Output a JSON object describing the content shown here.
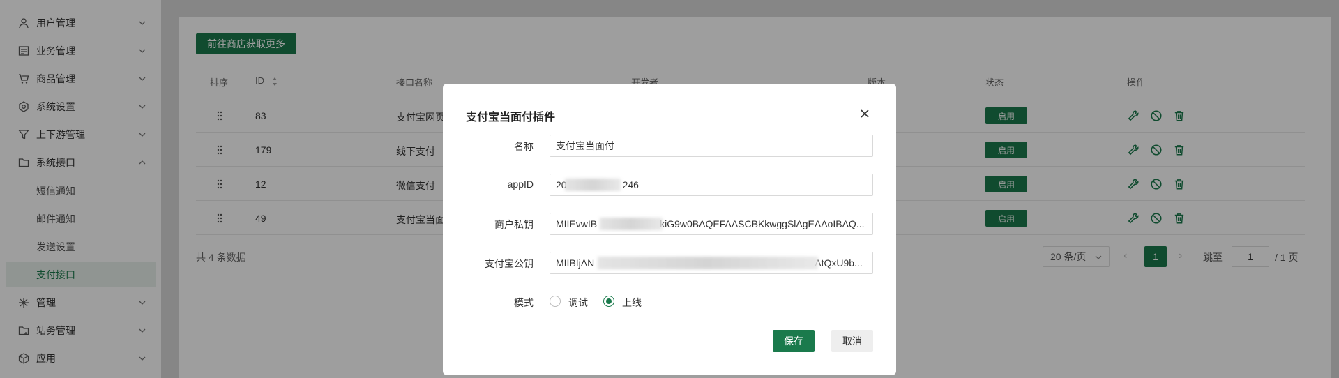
{
  "sidebar": {
    "items": [
      {
        "label": "用户管理",
        "icon": "user-icon"
      },
      {
        "label": "业务管理",
        "icon": "list-icon"
      },
      {
        "label": "商品管理",
        "icon": "cart-icon"
      },
      {
        "label": "系统设置",
        "icon": "gear-icon"
      },
      {
        "label": "上下游管理",
        "icon": "filter-icon"
      },
      {
        "label": "系统接口",
        "icon": "folder-icon"
      },
      {
        "label": "管理",
        "icon": "sparkle-icon"
      },
      {
        "label": "站务管理",
        "icon": "folder-add-icon"
      },
      {
        "label": "应用",
        "icon": "box-icon"
      }
    ],
    "sub_items": [
      "短信通知",
      "邮件通知",
      "发送设置",
      "支付接口"
    ]
  },
  "toolbar": {
    "store_button": "前往商店获取更多"
  },
  "table": {
    "headers": {
      "sort": "排序",
      "id": "ID",
      "name": "接口名称",
      "developer": "开发者",
      "version": "版本",
      "status": "状态",
      "actions": "操作"
    },
    "rows": [
      {
        "id": "83",
        "name": "支付宝网页",
        "status": "启用"
      },
      {
        "id": "179",
        "name": "线下支付",
        "status": "启用"
      },
      {
        "id": "12",
        "name": "微信支付",
        "status": "启用"
      },
      {
        "id": "49",
        "name": "支付宝当面",
        "status": "启用"
      }
    ],
    "total": "共 4 条数据"
  },
  "pagination": {
    "page_size": "20 条/页",
    "current": "1",
    "jump_label": "跳至",
    "jump_value": "1",
    "total_pages": "/ 1 页"
  },
  "dialog": {
    "title": "支付宝当面付插件",
    "fields": {
      "name_label": "名称",
      "name_value": "支付宝当面付",
      "appid_label": "appID",
      "appid_value_start": "20",
      "appid_value_end": "246",
      "private_key_label": "商户私钥",
      "private_key_start": "MIIEvwIB",
      "private_key_end": "kiG9w0BAQEFAASCBKkwggSlAgEAAoIBAQ...",
      "public_key_label": "支付宝公钥",
      "public_key_start": "MIIBIjAN",
      "public_key_end": "AtQxU9b...",
      "mode_label": "模式",
      "mode_debug": "调试",
      "mode_live": "上线"
    },
    "mode_selected": "上线",
    "save": "保存",
    "cancel": "取消"
  },
  "colors": {
    "accent": "#1a7a4c"
  }
}
